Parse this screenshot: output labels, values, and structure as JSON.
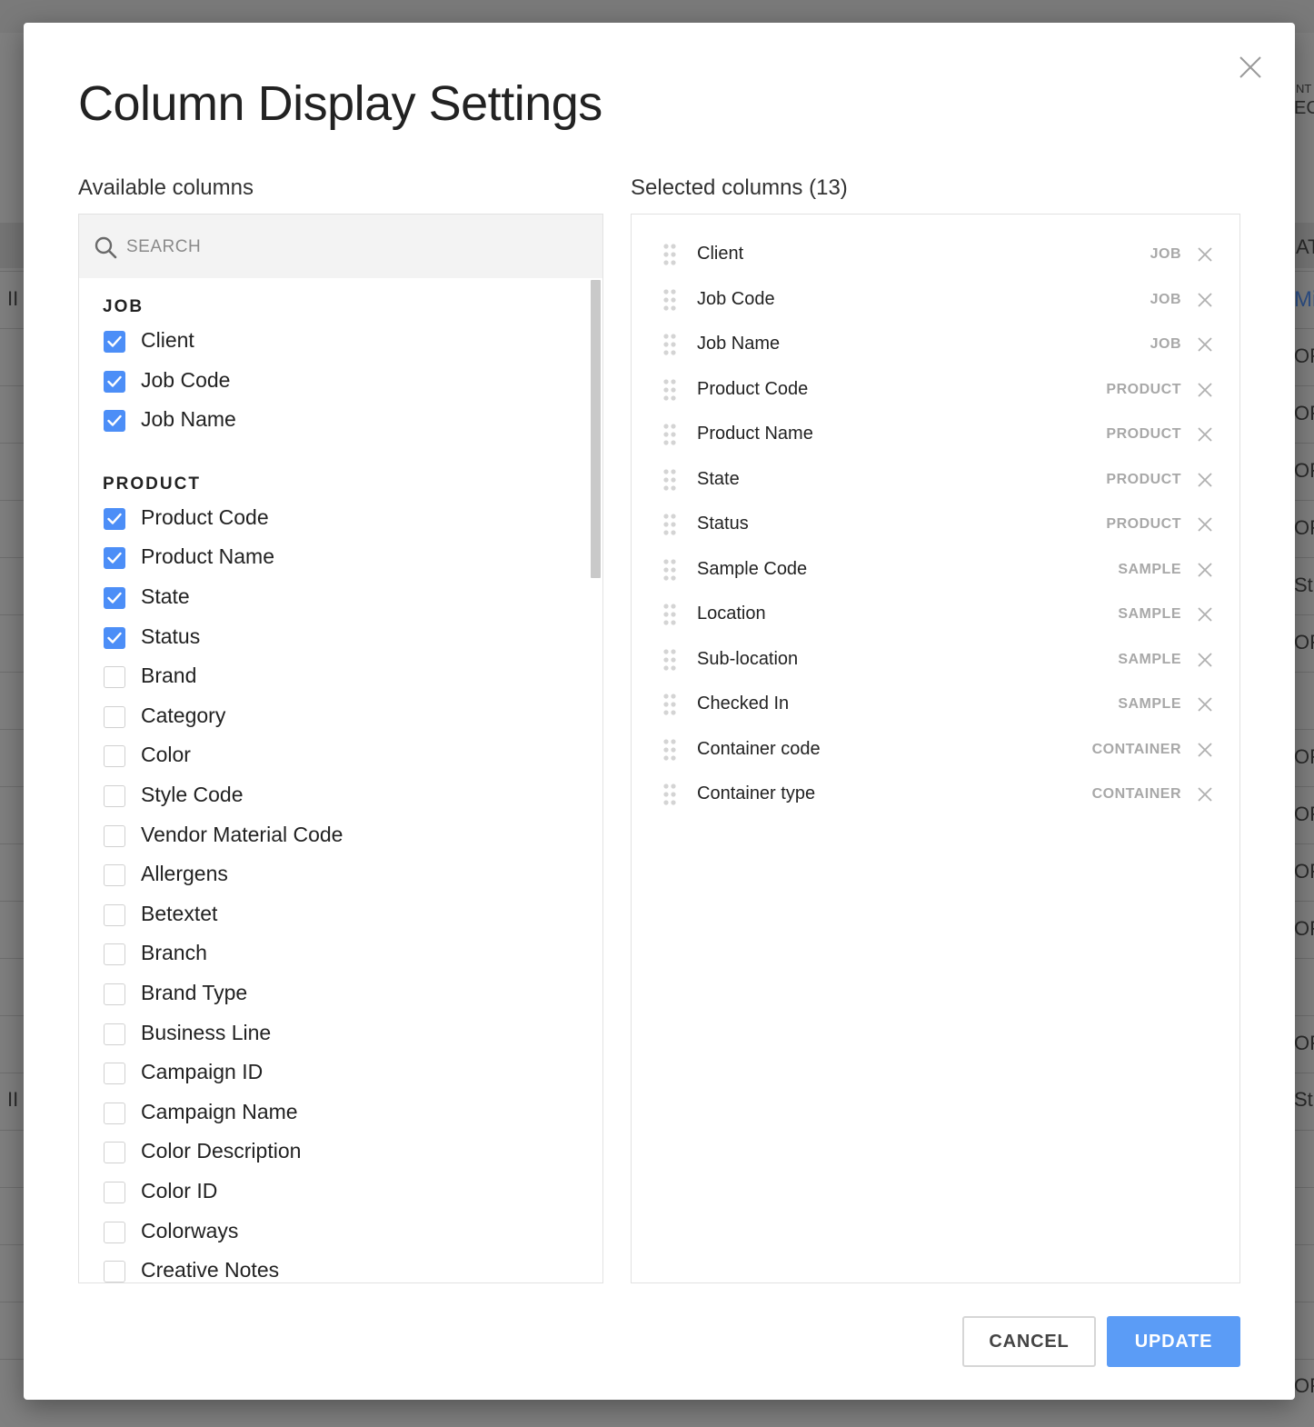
{
  "background": {
    "fragments": [
      "NT",
      "EC",
      "AT",
      "II",
      "Mi",
      "OF",
      "OF",
      "OF",
      "OF",
      "St",
      "OF",
      "OF",
      "OF",
      "OF",
      "OF",
      "OF",
      "II",
      "St",
      "OF"
    ]
  },
  "modal": {
    "title": "Column Display Settings",
    "available_label": "Available columns",
    "selected_label": "Selected columns (13)",
    "search": {
      "placeholder": "SEARCH",
      "value": ""
    },
    "groups": [
      {
        "title": "JOB",
        "items": [
          {
            "label": "Client",
            "checked": true
          },
          {
            "label": "Job Code",
            "checked": true
          },
          {
            "label": "Job Name",
            "checked": true
          }
        ]
      },
      {
        "title": "PRODUCT",
        "items": [
          {
            "label": "Product Code",
            "checked": true
          },
          {
            "label": "Product Name",
            "checked": true
          },
          {
            "label": "State",
            "checked": true
          },
          {
            "label": "Status",
            "checked": true
          },
          {
            "label": "Brand",
            "checked": false
          },
          {
            "label": "Category",
            "checked": false
          },
          {
            "label": "Color",
            "checked": false
          },
          {
            "label": "Style Code",
            "checked": false
          },
          {
            "label": "Vendor Material Code",
            "checked": false
          },
          {
            "label": "Allergens",
            "checked": false
          },
          {
            "label": "Betextet",
            "checked": false
          },
          {
            "label": "Branch",
            "checked": false
          },
          {
            "label": "Brand Type",
            "checked": false
          },
          {
            "label": "Business Line",
            "checked": false
          },
          {
            "label": "Campaign ID",
            "checked": false
          },
          {
            "label": "Campaign Name",
            "checked": false
          },
          {
            "label": "Color Description",
            "checked": false
          },
          {
            "label": "Color ID",
            "checked": false
          },
          {
            "label": "Colorways",
            "checked": false
          },
          {
            "label": "Creative Notes",
            "checked": false
          }
        ]
      }
    ],
    "selected": [
      {
        "label": "Client",
        "group": "JOB"
      },
      {
        "label": "Job Code",
        "group": "JOB"
      },
      {
        "label": "Job Name",
        "group": "JOB"
      },
      {
        "label": "Product Code",
        "group": "PRODUCT"
      },
      {
        "label": "Product Name",
        "group": "PRODUCT"
      },
      {
        "label": "State",
        "group": "PRODUCT"
      },
      {
        "label": "Status",
        "group": "PRODUCT"
      },
      {
        "label": "Sample Code",
        "group": "SAMPLE"
      },
      {
        "label": "Location",
        "group": "SAMPLE"
      },
      {
        "label": "Sub-location",
        "group": "SAMPLE"
      },
      {
        "label": "Checked In",
        "group": "SAMPLE"
      },
      {
        "label": "Container code",
        "group": "CONTAINER"
      },
      {
        "label": "Container type",
        "group": "CONTAINER"
      }
    ],
    "buttons": {
      "cancel": "CANCEL",
      "update": "UPDATE"
    }
  },
  "colors": {
    "accent": "#5b9cf6",
    "checkbox": "#4c8ef7",
    "overlay": "#7f7f7f",
    "tag_gray": "#a8a8a8"
  },
  "icons": {
    "close": "close-icon",
    "search": "search-icon",
    "drag": "drag-handle-icon",
    "remove": "remove-icon",
    "check": "check-icon"
  }
}
